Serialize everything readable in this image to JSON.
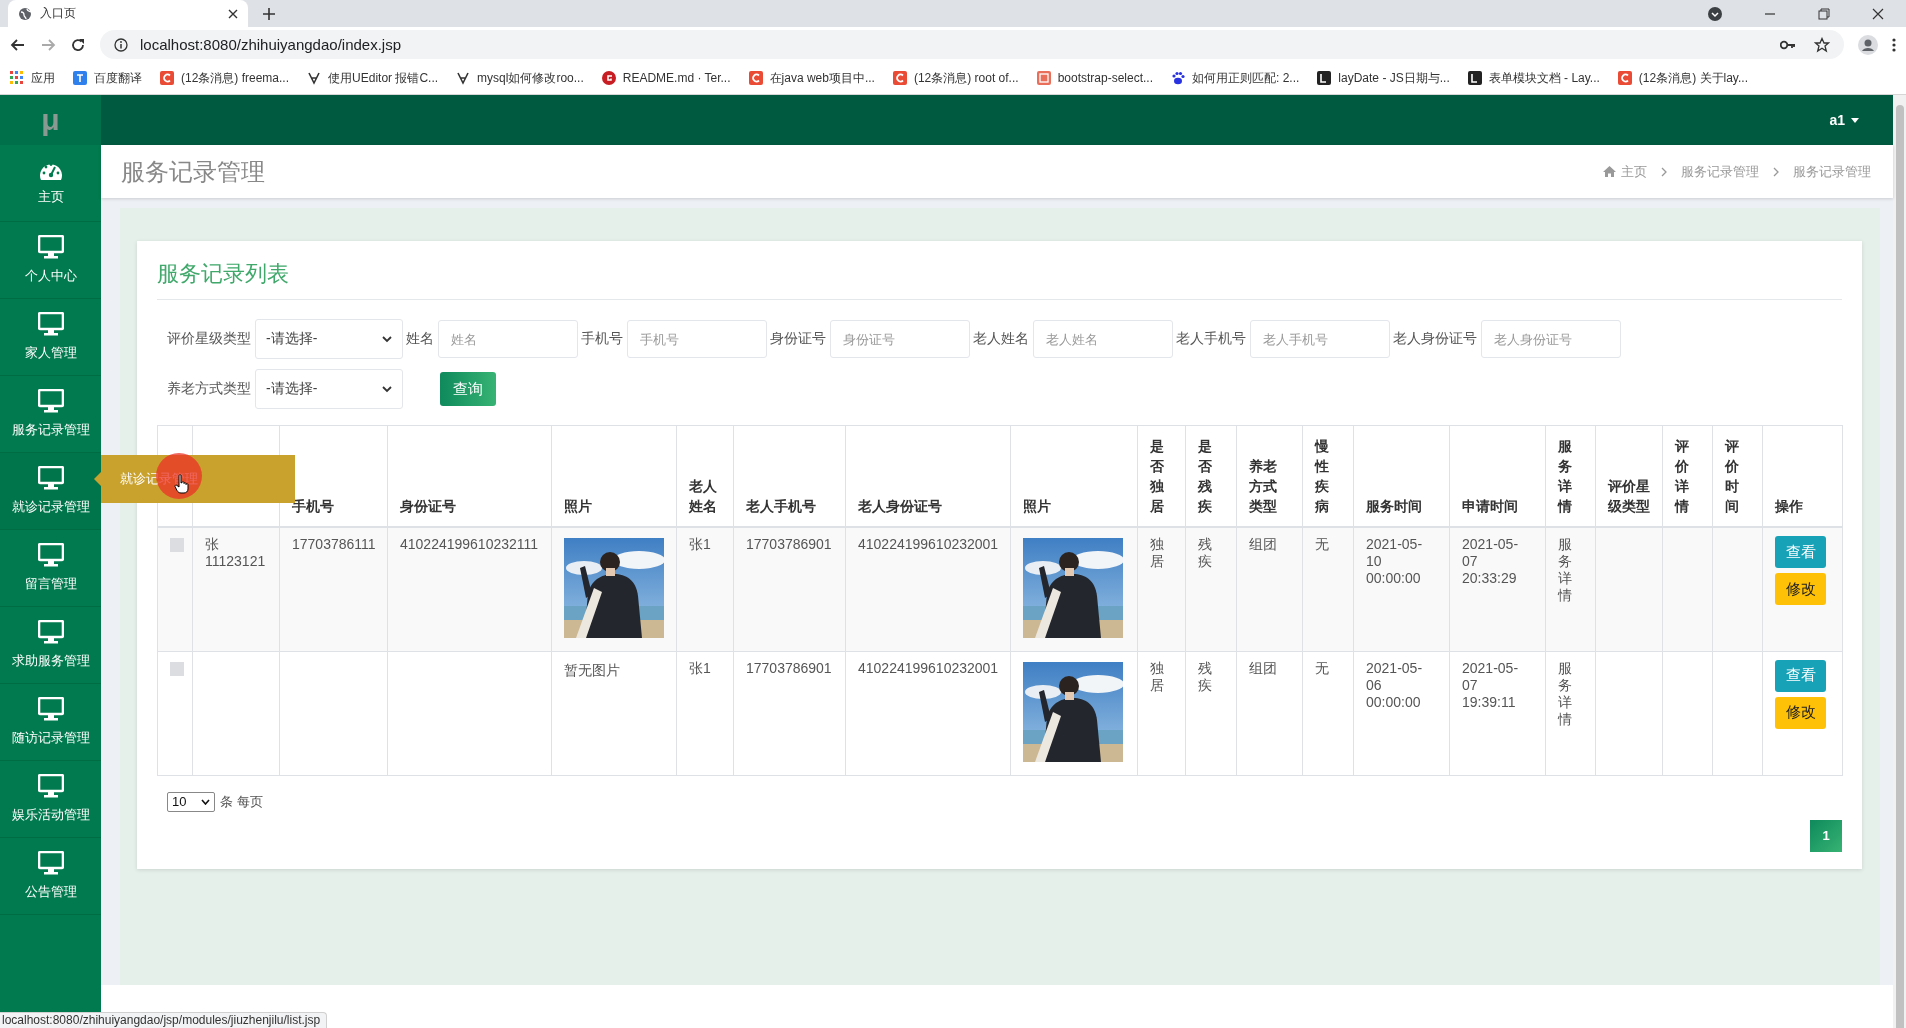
{
  "browser": {
    "tab_title": "入口页",
    "url": "localhost:8080/zhihuiyangdao/index.jsp",
    "bookmarks": [
      {
        "kind": "apps",
        "label": "应用"
      },
      {
        "kind": "translate",
        "label": "百度翻译"
      },
      {
        "kind": "csdn",
        "label": "(12条消息) freema..."
      },
      {
        "kind": "ueditor",
        "label": "使用UEditor 报错C..."
      },
      {
        "kind": "ueditor",
        "label": "mysql如何修改roo..."
      },
      {
        "kind": "gitee",
        "label": "README.md · Ter..."
      },
      {
        "kind": "csdn",
        "label": "在java web项目中..."
      },
      {
        "kind": "csdn",
        "label": "(12条消息) root of..."
      },
      {
        "kind": "jianshu",
        "label": "bootstrap-select..."
      },
      {
        "kind": "baidu",
        "label": "如何用正则匹配: 2..."
      },
      {
        "kind": "layui",
        "label": "layDate - JS日期与..."
      },
      {
        "kind": "layui",
        "label": "表单模块文档 - Lay..."
      },
      {
        "kind": "csdn",
        "label": "(12条消息) 关于lay..."
      }
    ],
    "status_url": "localhost:8080/zhihuiyangdao/jsp/modules/jiuzhenjilu/list.jsp"
  },
  "logo": "μ",
  "user": "a1",
  "sidebar": {
    "items": [
      {
        "kind": "dashboard",
        "label": "主页"
      },
      {
        "kind": "monitor",
        "label": "个人中心"
      },
      {
        "kind": "monitor",
        "label": "家人管理"
      },
      {
        "kind": "monitor",
        "label": "服务记录管理"
      },
      {
        "kind": "monitor",
        "label": "就诊记录管理",
        "tooltip": "就诊记录管理"
      },
      {
        "kind": "monitor",
        "label": "留言管理"
      },
      {
        "kind": "monitor",
        "label": "求助服务管理"
      },
      {
        "kind": "monitor",
        "label": "随访记录管理"
      },
      {
        "kind": "monitor",
        "label": "娱乐活动管理"
      },
      {
        "kind": "monitor",
        "label": "公告管理"
      }
    ]
  },
  "page_title": "服务记录管理",
  "breadcrumb": [
    {
      "kind": "home",
      "label": "主页"
    },
    {
      "kind": "link",
      "label": "服务记录管理"
    },
    {
      "kind": "link",
      "label": "服务记录管理"
    }
  ],
  "card_title": "服务记录列表",
  "filters": [
    {
      "kind": "select",
      "label": "评价星级类型",
      "value": "-请选择-"
    },
    {
      "kind": "input",
      "label": "姓名",
      "placeholder": "姓名"
    },
    {
      "kind": "input",
      "label": "手机号",
      "placeholder": "手机号"
    },
    {
      "kind": "input",
      "label": "身份证号",
      "placeholder": "身份证号"
    },
    {
      "kind": "input",
      "label": "老人姓名",
      "placeholder": "老人姓名"
    },
    {
      "kind": "input",
      "label": "老人手机号",
      "placeholder": "老人手机号"
    },
    {
      "kind": "input",
      "label": "老人身份证号",
      "placeholder": "老人身份证号"
    },
    {
      "kind": "select",
      "label": "养老方式类型",
      "value": "-请选择-"
    }
  ],
  "search_button": "查询",
  "table": {
    "columns": [
      "手机号",
      "身份证号",
      "照片",
      "老人姓名",
      "老人手机号",
      "老人身份证号",
      "照片",
      "是否独居",
      "是否残疾",
      "养老方式类型",
      "慢性疾病",
      "服务时间",
      "申请时间",
      "服务详情",
      "评价星级类型",
      "评价详情",
      "评价时间",
      "操作"
    ],
    "rows": [
      {
        "checked": false,
        "column_2": "张11123121",
        "phone": "17703786111",
        "id_number": "410224199610232111",
        "photo": {
          "kind": "picture"
        },
        "elder_name": "张1",
        "elder_phone": "17703786901",
        "elder_id_number": "410224199610232001",
        "elder_photo": {
          "kind": "picture"
        },
        "lives_alone": "独居",
        "disability": "残疾",
        "care_type": "组团",
        "chronic_disease": "无",
        "service_time": "2021-05-10 00:00:00",
        "apply_time": "2021-05-07 20:33:29",
        "service_detail": "服务详情",
        "actions": [
          {
            "kind": "view",
            "label": "查看"
          },
          {
            "kind": "edit",
            "label": "修改"
          }
        ]
      },
      {
        "checked": false,
        "photo": {
          "kind": "text",
          "text": "暂无图片"
        },
        "elder_name": "张1",
        "elder_phone": "17703786901",
        "elder_id_number": "410224199610232001",
        "elder_photo": {
          "kind": "picture"
        },
        "lives_alone": "独居",
        "disability": "残疾",
        "care_type": "组团",
        "chronic_disease": "无",
        "service_time": "2021-05-06 00:00:00",
        "apply_time": "2021-05-07 19:39:11",
        "service_detail": "服务详情",
        "actions": [
          {
            "kind": "view",
            "label": "查看"
          },
          {
            "kind": "edit",
            "label": "修改"
          }
        ]
      }
    ]
  },
  "page_size": "10",
  "page_size_suffix": "条 每页",
  "pagination": [
    {
      "label": "1",
      "selected": true
    }
  ]
}
